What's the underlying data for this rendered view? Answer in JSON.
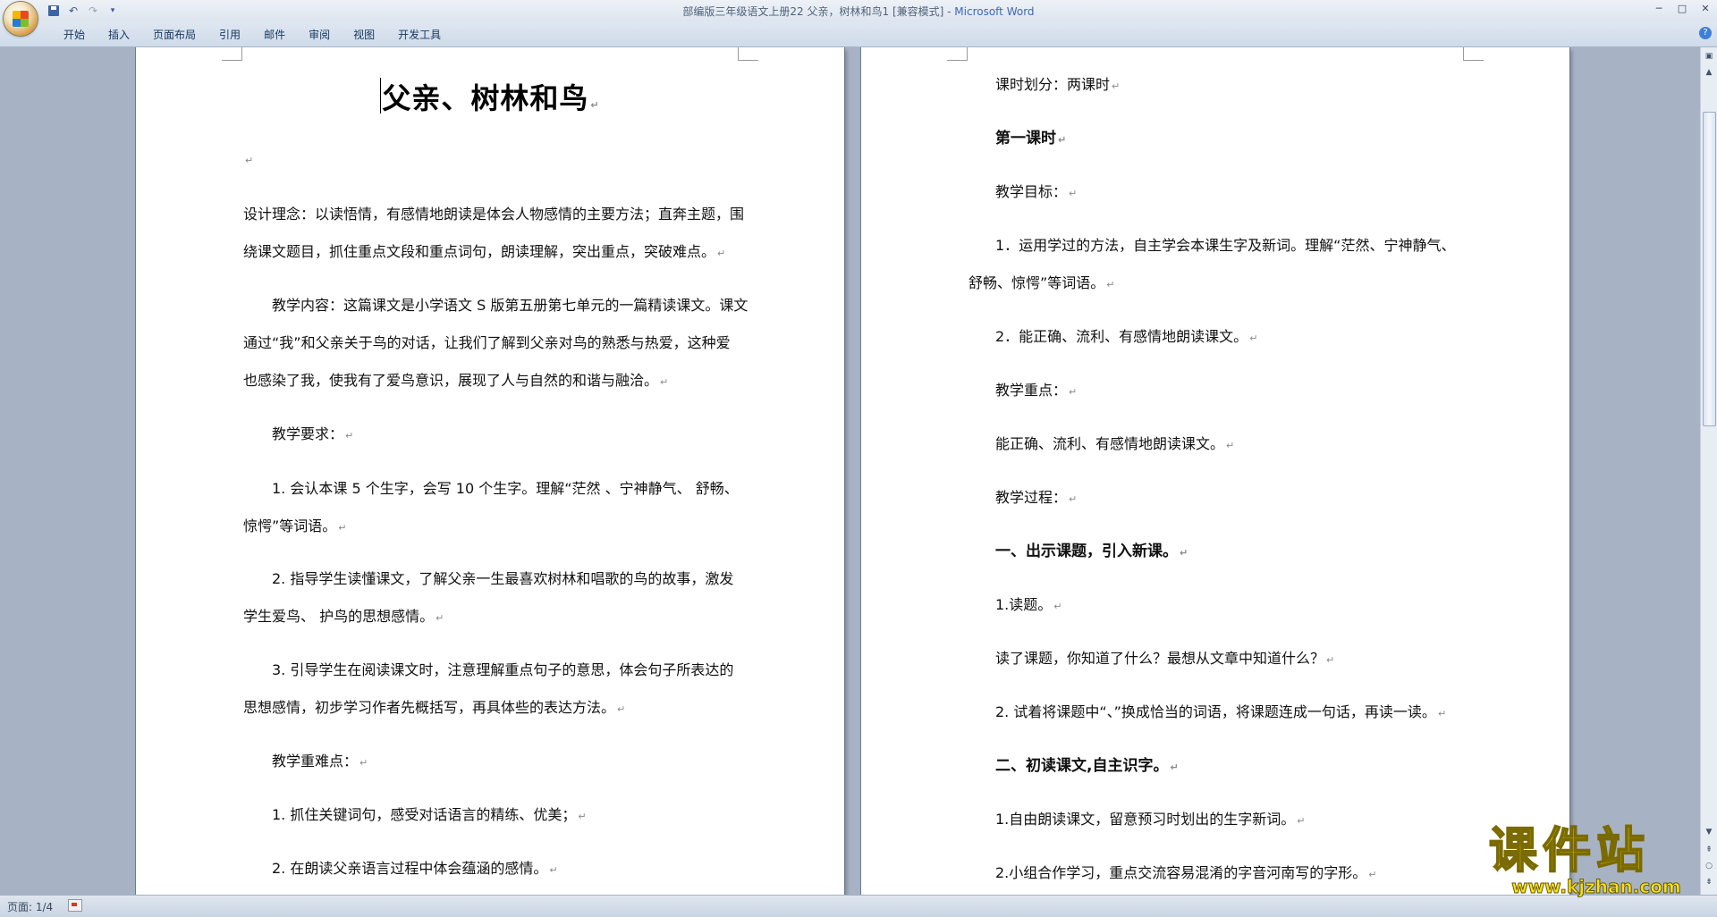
{
  "titlebar": {
    "title_prefix": "部编版三年级语文上册22 父亲，树林和鸟1 [兼容模式] - ",
    "app_name": "Microsoft Word",
    "controls": [
      "─",
      "□",
      "✕"
    ]
  },
  "ribbon": {
    "tabs": [
      "开始",
      "插入",
      "页面布局",
      "引用",
      "邮件",
      "审阅",
      "视图",
      "开发工具"
    ]
  },
  "left_page": {
    "title": "父亲、树林和鸟",
    "empty_mark": "↵",
    "paragraphs": [
      "设计理念：以读悟情，有感情地朗读是体会人物感情的主要方法；直奔主题，围",
      "绕课文题目，抓住重点文段和重点词句，朗读理解，突出重点，突破难点。",
      "教学内容：这篇课文是小学语文 S 版第五册第七单元的一篇精读课文。课文",
      "通过“我”和父亲关于鸟的对话，让我们了解到父亲对鸟的熟悉与热爱，这种爱",
      "也感染了我，使我有了爱鸟意识，展现了人与自然的和谐与融洽。",
      "教学要求：",
      "1. 会认本课 5 个生字，会写 10 个生字。理解“茫然 、宁神静气、 舒畅、",
      "惊愕”等词语。",
      "2. 指导学生读懂课文，了解父亲一生最喜欢树林和唱歌的鸟的故事，激发",
      "学生爱鸟、 护鸟的思想感情。",
      "3. 引导学生在阅读课文时，注意理解重点句子的意思，体会句子所表达的",
      "思想感情，初步学习作者先概括写，再具体些的表达方法。",
      "教学重难点：",
      "1. 抓住关键词句，感受对话语言的精练、优美；",
      "2. 在朗读父亲语言过程中体会蕴涵的感情。"
    ]
  },
  "right_page": {
    "paragraphs": [
      "课时划分：两课时",
      "第一课时",
      "教学目标：",
      "1．运用学过的方法，自主学会本课生字及新词。理解“茫然、宁神静气、",
      "舒畅、惊愕”等词语。",
      "2．能正确、流利、有感情地朗读课文。",
      "教学重点：",
      "能正确、流利、有感情地朗读课文。",
      "教学过程：",
      "一、出示课题，引入新课。",
      "1.读题。",
      "读了课题，你知道了什么？最想从文章中知道什么？",
      "2. 试着将课题中“、”换成恰当的词语，将课题连成一句话，再读一读。",
      "二、初读课文,自主识字。",
      "1.自由朗读课文，留意预习时划出的生字新词。",
      "2.小组合作学习，重点交流容易混淆的字音河南写的字形。"
    ]
  },
  "statusbar": {
    "page_info": "页面: 1/4"
  },
  "watermark": {
    "logo": "课件站",
    "url": "www.kjzhan.com"
  }
}
